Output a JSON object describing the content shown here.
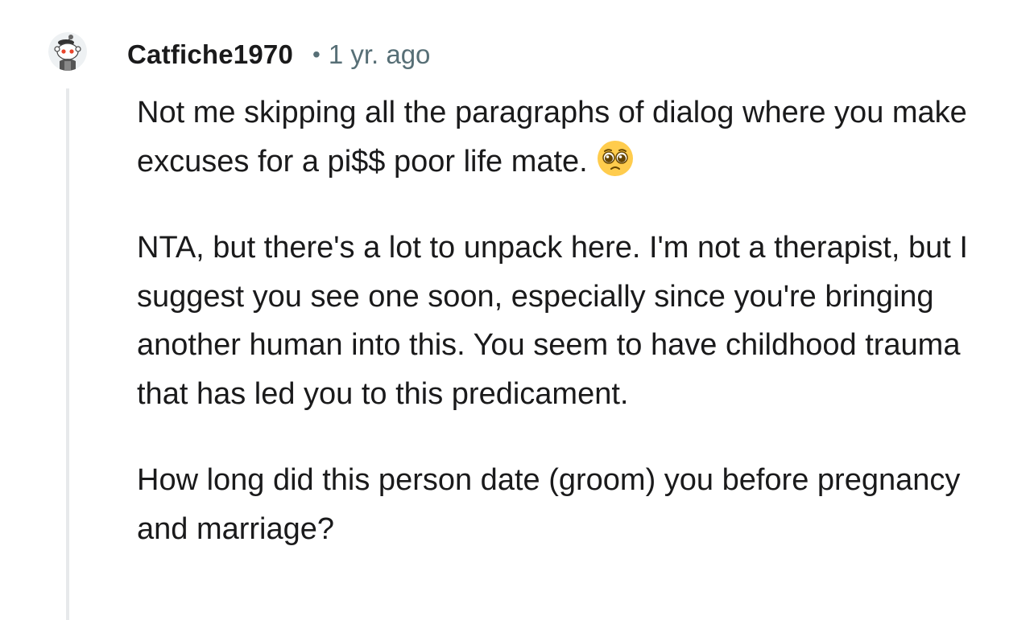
{
  "comment": {
    "author": "Catfiche1970",
    "separator": "•",
    "timestamp": "1 yr. ago",
    "avatar_icon": "snoo-avatar-icon",
    "paragraphs": [
      "Not me skipping all the paragraphs of dialog where you make excuses for a pi$$ poor life mate.",
      "NTA, but there's a lot to unpack here. I'm not a therapist, but I suggest you see one soon, especially since you're bringing another human into this. You seem to have childhood trauma that has led you to this predicament.",
      "How long did this person date (groom) you before pregnancy and marriage?"
    ],
    "emoji_icon": "pleading-face-emoji-icon"
  },
  "colors": {
    "text": "#1a1a1b",
    "meta": "#576f76",
    "thread_line": "#e7e9eb",
    "emoji_face": "#ffcc4d"
  }
}
